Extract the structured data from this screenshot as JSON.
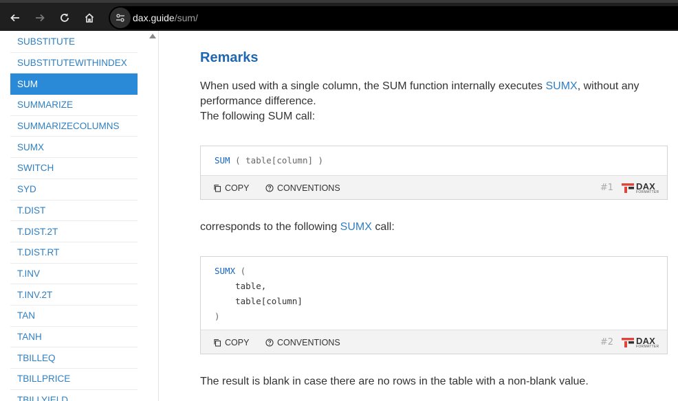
{
  "browser": {
    "url_host": "dax.guide",
    "url_path": "/sum/"
  },
  "sidebar": {
    "items": [
      {
        "label": "SUBSTITUTE"
      },
      {
        "label": "SUBSTITUTEWITHINDEX"
      },
      {
        "label": "SUM",
        "active": true
      },
      {
        "label": "SUMMARIZE"
      },
      {
        "label": "SUMMARIZECOLUMNS"
      },
      {
        "label": "SUMX"
      },
      {
        "label": "SWITCH"
      },
      {
        "label": "SYD"
      },
      {
        "label": "T.DIST"
      },
      {
        "label": "T.DIST.2T"
      },
      {
        "label": "T.DIST.RT"
      },
      {
        "label": "T.INV"
      },
      {
        "label": "T.INV.2T"
      },
      {
        "label": "TAN"
      },
      {
        "label": "TANH"
      },
      {
        "label": "TBILLEQ"
      },
      {
        "label": "TBILLPRICE"
      },
      {
        "label": "TBILLYIELD"
      }
    ]
  },
  "main": {
    "heading": "Remarks",
    "para1_a": "When used with a single column, the SUM function internally executes ",
    "para1_link": "SUMX",
    "para1_b": ", without any performance difference.",
    "para2": "The following SUM call:",
    "para3_a": "corresponds to the following ",
    "para3_link": "SUMX",
    "para3_b": " call:",
    "para4": "The result is blank in case there are no rows in the table with a non-blank value.",
    "code1": {
      "fn": "SUM",
      "args": "( table[column] )",
      "number": "#1"
    },
    "code2": {
      "fn": "SUMX",
      "open": "(",
      "line2": "table,",
      "line3": "table[column]",
      "close": ")",
      "number": "#2"
    },
    "copy_label": "COPY",
    "conventions_label": "CONVENTIONS",
    "logo_text": "DAX",
    "logo_sub": "FORMATTER"
  },
  "colors": {
    "link": "#2f7fc1",
    "heading": "#1f67b1",
    "active_bg": "#2b8ad8",
    "logo_red": "#e0453b"
  }
}
